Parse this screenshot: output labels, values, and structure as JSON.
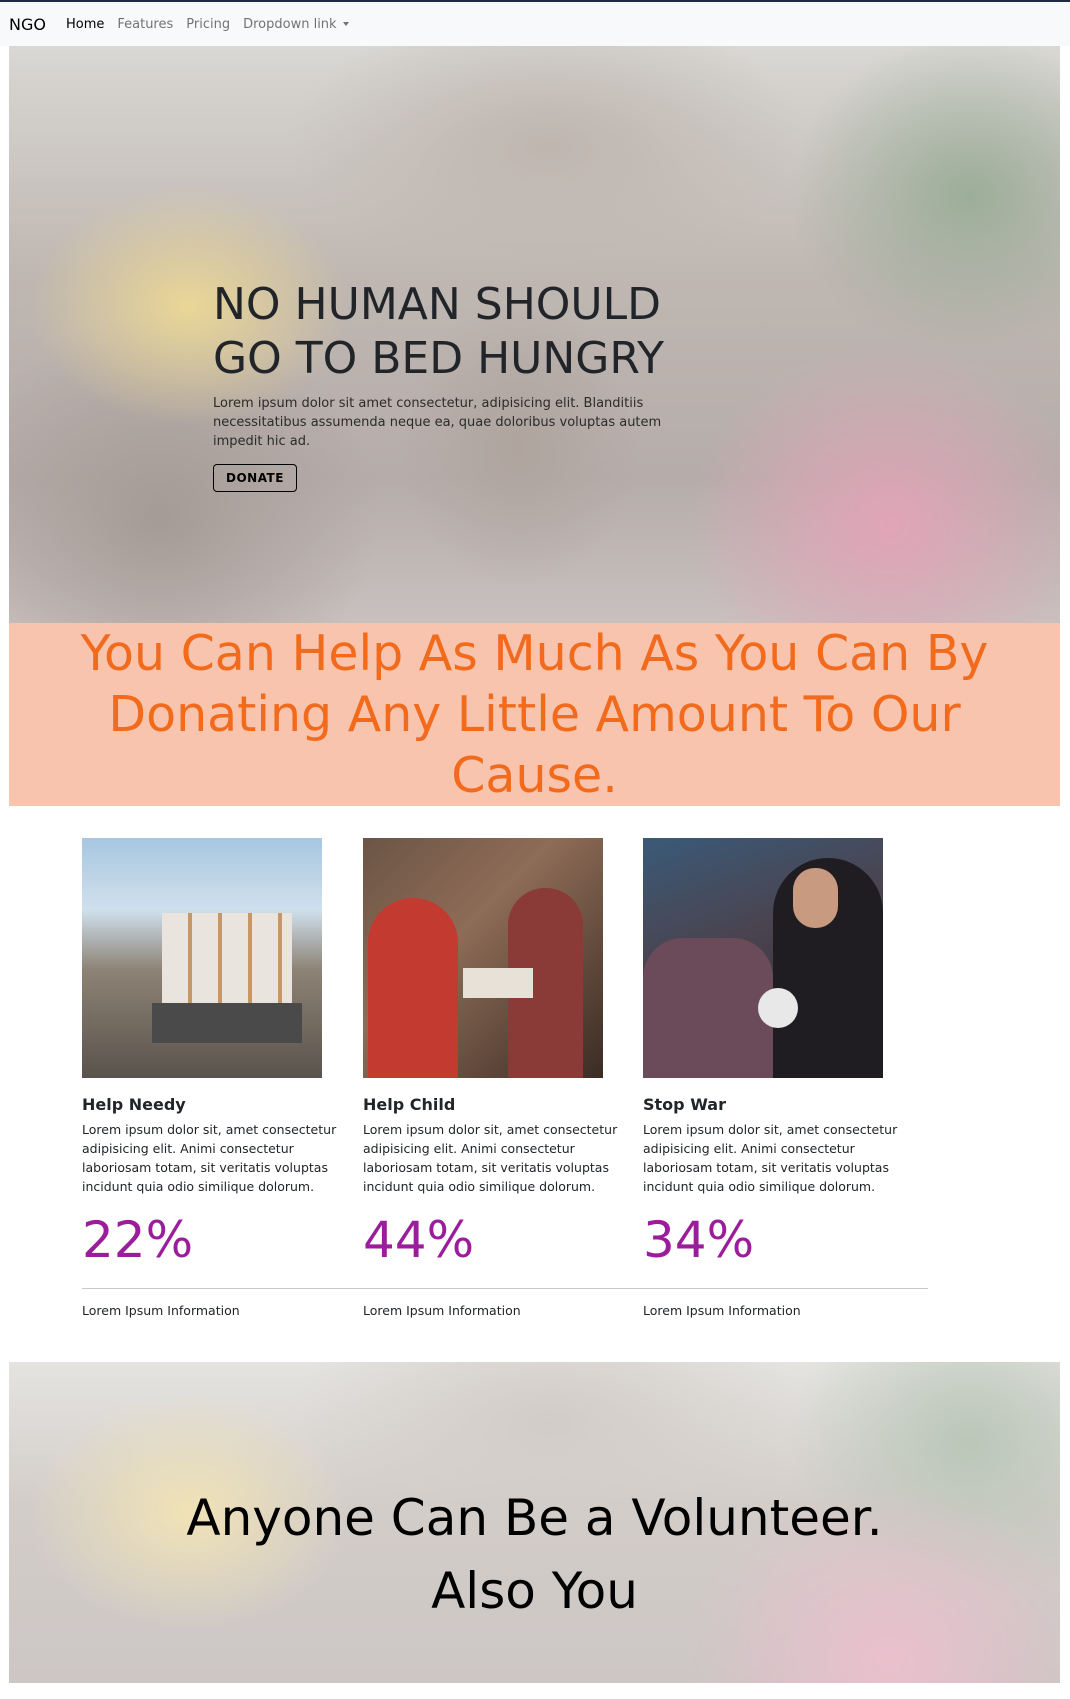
{
  "navbar": {
    "brand": "NGO",
    "links": [
      {
        "label": "Home",
        "active": true
      },
      {
        "label": "Features",
        "active": false
      },
      {
        "label": "Pricing",
        "active": false
      },
      {
        "label": "Dropdown link",
        "active": false
      }
    ]
  },
  "hero": {
    "title_line1": "NO HUMAN SHOULD",
    "title_line2": "GO TO BED HUNGRY",
    "text": "Lorem ipsum dolor sit amet consectetur, adipisicing elit. Blanditiis necessitatibus assumenda neque ea, quae doloribus voluptas autem impedit hic ad.",
    "button_label": "DONATE"
  },
  "banner": {
    "text": "You Can Help As Much As You Can By Donating Any Little Amount To Our Cause."
  },
  "cards": [
    {
      "title": "Help Needy",
      "text": "Lorem ipsum dolor sit, amet consectetur adipisicing elit. Animi consectetur laboriosam totam, sit veritatis voluptas incidunt quia odio similique dolorum.",
      "percent": "22%",
      "info": "Lorem Ipsum Information"
    },
    {
      "title": "Help Child",
      "text": "Lorem ipsum dolor sit, amet consectetur adipisicing elit. Animi consectetur laboriosam totam, sit veritatis voluptas incidunt quia odio similique dolorum.",
      "percent": "44%",
      "info": "Lorem Ipsum Information"
    },
    {
      "title": "Stop War",
      "text": "Lorem ipsum dolor sit, amet consectetur adipisicing elit. Animi consectetur laboriosam totam, sit veritatis voluptas incidunt quia odio similique dolorum.",
      "percent": "34%",
      "info": "Lorem Ipsum Information"
    }
  ],
  "volunteer": {
    "title_line1": "Anyone Can Be a Volunteer.",
    "title_line2": "Also You"
  },
  "colors": {
    "banner_bg": "#f8c4ad",
    "banner_text": "#f26b1d",
    "percent": "#9b1d9b"
  }
}
